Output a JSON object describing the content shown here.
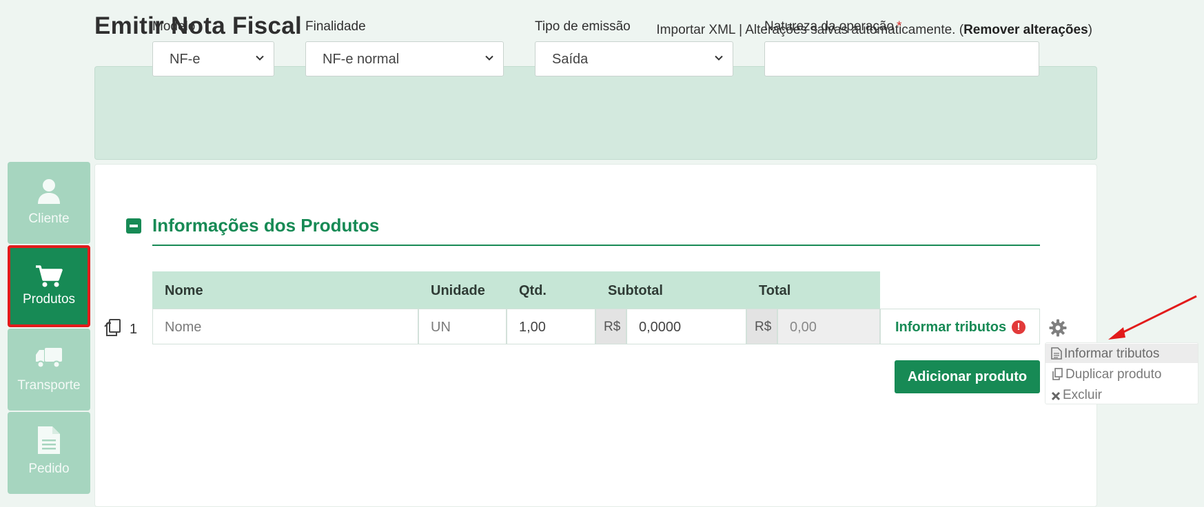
{
  "header": {
    "title": "Emitir Nota Fiscal",
    "import_xml": "Importar XML",
    "separator": " | ",
    "saved_text": "Alterações salvas automaticamente. (",
    "remove_changes": "Remover alterações",
    "close_paren": ")"
  },
  "form": {
    "modelo": {
      "label": "Modelo",
      "value": "NF-e"
    },
    "finalidade": {
      "label": "Finalidade",
      "value": "NF-e normal"
    },
    "tipo_emissao": {
      "label": "Tipo de emissão",
      "value": "Saída"
    },
    "natureza": {
      "label": "Natureza da operação",
      "required_mark": "*",
      "value": ""
    }
  },
  "sidebar": {
    "items": [
      {
        "label": "Cliente",
        "icon": "user-icon",
        "active": false
      },
      {
        "label": "Produtos",
        "icon": "cart-icon",
        "active": true
      },
      {
        "label": "Transporte",
        "icon": "truck-icon",
        "active": false
      },
      {
        "label": "Pedido",
        "icon": "document-icon",
        "active": false
      }
    ]
  },
  "section": {
    "title": "Informações dos Produtos"
  },
  "table": {
    "headers": [
      "Nome",
      "Unidade",
      "Qtd.",
      "Subtotal",
      "Total"
    ],
    "rows": [
      {
        "number": "1",
        "nome_placeholder": "Nome",
        "unidade": "UN",
        "qtd": "1,00",
        "currency": "R$",
        "subtotal": "0,0000",
        "total": "0,00",
        "tributos_label": "Informar tributos",
        "alert": "!"
      }
    ]
  },
  "actions": {
    "add_product": "Adicionar produto"
  },
  "dropdown": {
    "items": [
      {
        "label": "Informar tributos",
        "icon": "file-icon"
      },
      {
        "label": "Duplicar produto",
        "icon": "copy-icon"
      },
      {
        "label": "Excluir",
        "icon": "close-icon"
      }
    ]
  },
  "colors": {
    "brand_green": "#178a55",
    "panel_green": "#d3e9de",
    "annotation_red": "#e21b1b"
  }
}
